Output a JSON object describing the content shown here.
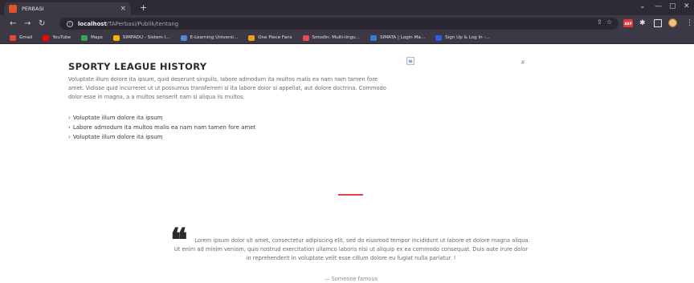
{
  "browser": {
    "tab_title": "PERBASI",
    "tab_close": "×",
    "new_tab": "+",
    "window_controls": [
      "⌄",
      "—",
      "▢",
      "✕"
    ],
    "url_host": "localhost",
    "url_path": "/TAPerbasi/Publik/tentang",
    "ext_abp": "ABP",
    "bookmarks": [
      {
        "label": "Gmail",
        "color": "#ea4335"
      },
      {
        "label": "YouTube",
        "color": "#ff0000"
      },
      {
        "label": "Maps",
        "color": "#34a853"
      },
      {
        "label": "SIMPADU - Sistem I...",
        "color": "#f4b400"
      },
      {
        "label": "E-Learning Universi...",
        "color": "#4b8bd9"
      },
      {
        "label": "One Piece Fans",
        "color": "#f29c1f"
      },
      {
        "label": "Smodin: Multi-lingu...",
        "color": "#e84d4d"
      },
      {
        "label": "SIMATA | Login Ma...",
        "color": "#3a7bd5"
      },
      {
        "label": "Sign Up & Log In -...",
        "color": "#2d5be3"
      }
    ]
  },
  "about": {
    "title": "SPORTY LEAGUE HISTORY",
    "paragraph": "Voluptate illum dolore ita ipsum, quid deserunt singulis, labore admodum ita multos malis ea nam nam tamen fore amet. Vidisse quid incurreret ut ut possumus transferrem si ita labore dolor si appellat, aut dolore doctrina. Commodo dolor esse in magna, a a multos senserit nam si aliqua iis multos.",
    "bullet_symbol": "›",
    "items": [
      "Voluptate illum dolore ita ipsum",
      "Labore admodum ita multos malis ea nam nam tamen fore amet",
      "Voluptate illum dolore ita ipsum"
    ],
    "hash_text": "#"
  },
  "quote": {
    "mark": "❝",
    "text": "Lorem ipsum dolor sit amet, consectetur adipiscing elit, sed do eiusmod tempor incididunt ut labore et dolore magna aliqua. Ut enim ad minim veniam, quis nostrud exercitation ullamco laboris nisi ut aliquip ex ea commodo consequat. Duis aute irure dolor in reprehenderit in voluptate velit esse cillum dolore eu fugiat nulla pariatur. !",
    "author": "— Someone famous"
  },
  "colors": {
    "accent": "#e84545",
    "chrome_dark": "#2d2a35",
    "chrome": "#3c3845"
  }
}
